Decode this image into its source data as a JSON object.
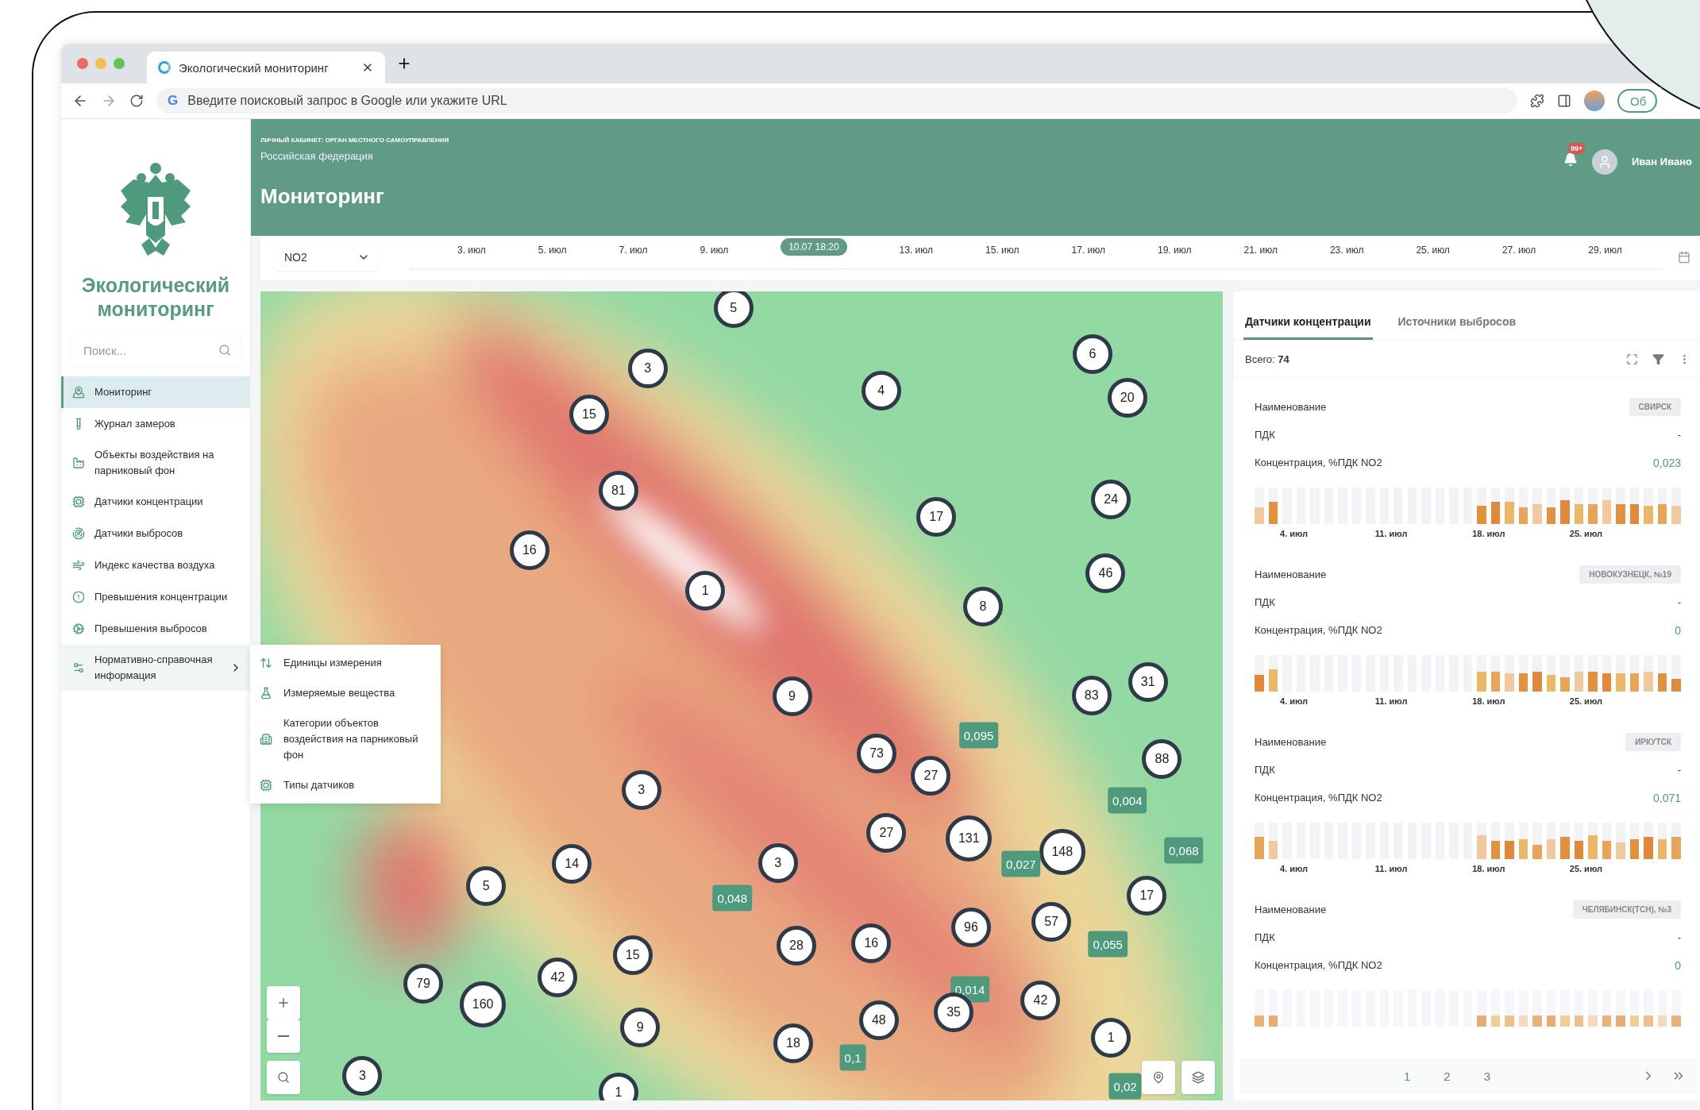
{
  "browser": {
    "search_engine_mark": "G",
    "tab_title": "Экологический мониторинг",
    "address_placeholder": "Введите поисковый запрос в Google или укажите URL",
    "profile_button": "Об"
  },
  "sidebar": {
    "title": "Экологический мониторинг",
    "search": {
      "placeholder": "Поиск..."
    },
    "items": [
      {
        "label": "Мониторинг",
        "selected": true,
        "expanded": false
      },
      {
        "label": "Журнал замеров",
        "selected": false,
        "expanded": false
      },
      {
        "label": "Объекты воздействия на парниковый фон",
        "selected": false,
        "expanded": false
      },
      {
        "label": "Датчики концентрации",
        "selected": false,
        "expanded": false
      },
      {
        "label": "Датчики выбросов",
        "selected": false,
        "expanded": false
      },
      {
        "label": "Индекс качества воздуха",
        "selected": false,
        "expanded": false
      },
      {
        "label": "Превышения концентрации",
        "selected": false,
        "expanded": false
      },
      {
        "label": "Превышения выбросов",
        "selected": false,
        "expanded": false
      },
      {
        "label": "Нормативно-справочная информация",
        "selected": false,
        "expanded": true,
        "children": [
          {
            "label": "Единицы измерения"
          },
          {
            "label": "Измеряемые вещества"
          },
          {
            "label": "Категории объектов воздействия на парниковый фон"
          },
          {
            "label": "Типы датчиков"
          }
        ]
      }
    ]
  },
  "header": {
    "account_label": "ЛИЧНЫЙ КАБИНЕТ: ОРГАН МЕСТНОГО САМОУПРАВЛЕНИЯ",
    "region": "Российская федерация",
    "title": "Мониторинг",
    "notifications_badge": "99+",
    "user_name": "Иван Ивано"
  },
  "timeline": {
    "substance": "NO2",
    "dates": [
      {
        "kind": "date",
        "label": "3. июл"
      },
      {
        "kind": "date",
        "label": "5. июл"
      },
      {
        "kind": "date",
        "label": "7. июл"
      },
      {
        "kind": "date",
        "label": "9. июл"
      },
      {
        "kind": "current",
        "label": "10.07 18:20"
      },
      {
        "kind": "date",
        "label": "13. июл"
      },
      {
        "kind": "date",
        "label": "15. июл"
      },
      {
        "kind": "date",
        "label": "17. июл"
      },
      {
        "kind": "date",
        "label": "19. июл"
      },
      {
        "kind": "date",
        "label": "21. июл"
      },
      {
        "kind": "date",
        "label": "23. июл"
      },
      {
        "kind": "date",
        "label": "25. июл"
      },
      {
        "kind": "date",
        "label": "27. июл"
      },
      {
        "kind": "date",
        "label": "29. июл"
      }
    ]
  },
  "map": {
    "markers": [
      {
        "kind": "cluster",
        "label": "5"
      },
      {
        "kind": "cluster",
        "label": "3"
      },
      {
        "kind": "cluster",
        "label": "4"
      },
      {
        "kind": "cluster",
        "label": "6"
      },
      {
        "kind": "cluster",
        "label": "20"
      },
      {
        "kind": "cluster",
        "label": "15"
      },
      {
        "kind": "cluster",
        "label": "81"
      },
      {
        "kind": "cluster",
        "label": "17"
      },
      {
        "kind": "cluster",
        "label": "24"
      },
      {
        "kind": "cluster",
        "label": "16"
      },
      {
        "kind": "cluster",
        "label": "1"
      },
      {
        "kind": "cluster",
        "label": "8"
      },
      {
        "kind": "cluster",
        "label": "46"
      },
      {
        "kind": "cluster",
        "label": "9"
      },
      {
        "kind": "cluster",
        "label": "83"
      },
      {
        "kind": "cluster",
        "label": "31"
      },
      {
        "kind": "cluster",
        "label": "73"
      },
      {
        "kind": "cluster",
        "label": "27"
      },
      {
        "kind": "cluster",
        "label": "88"
      },
      {
        "kind": "cluster",
        "label": "3"
      },
      {
        "kind": "cluster",
        "label": "27"
      },
      {
        "kind": "cluster",
        "label": "131"
      },
      {
        "kind": "cluster",
        "label": "148"
      },
      {
        "kind": "cluster",
        "label": "14"
      },
      {
        "kind": "cluster",
        "label": "3"
      },
      {
        "kind": "cluster",
        "label": "5"
      },
      {
        "kind": "cluster",
        "label": "17"
      },
      {
        "kind": "cluster",
        "label": "57"
      },
      {
        "kind": "cluster",
        "label": "96"
      },
      {
        "kind": "cluster",
        "label": "28"
      },
      {
        "kind": "cluster",
        "label": "16"
      },
      {
        "kind": "cluster",
        "label": "15"
      },
      {
        "kind": "cluster",
        "label": "79"
      },
      {
        "kind": "cluster",
        "label": "160"
      },
      {
        "kind": "cluster",
        "label": "42"
      },
      {
        "kind": "cluster",
        "label": "42"
      },
      {
        "kind": "cluster",
        "label": "9"
      },
      {
        "kind": "cluster",
        "label": "48"
      },
      {
        "kind": "cluster",
        "label": "35"
      },
      {
        "kind": "cluster",
        "label": "18"
      },
      {
        "kind": "cluster",
        "label": "1"
      },
      {
        "kind": "cluster",
        "label": "3"
      },
      {
        "kind": "cluster",
        "label": "1"
      },
      {
        "kind": "value",
        "label": "0,095"
      },
      {
        "kind": "value",
        "label": "0,004"
      },
      {
        "kind": "value",
        "label": "0,027"
      },
      {
        "kind": "value",
        "label": "0,068"
      },
      {
        "kind": "value",
        "label": "0,048"
      },
      {
        "kind": "value",
        "label": "0,055"
      },
      {
        "kind": "value",
        "label": "0,014"
      },
      {
        "kind": "value",
        "label": "0,1"
      },
      {
        "kind": "value",
        "label": "0,02"
      }
    ]
  },
  "panel": {
    "tabs": [
      {
        "label": "Датчики концентрации",
        "selected": true
      },
      {
        "label": "Источники выбросов",
        "selected": false
      }
    ],
    "total": "Всего: **74**",
    "cards": [
      {
        "name_label": "Наименование",
        "name": "СВИРСК",
        "limit_label": "ПДК",
        "limit": "-",
        "concentration_label": "Концентрация, %ПДК NO2",
        "concentration": "0,023",
        "axis_labels": [
          "4. июл",
          "11. июл",
          "18. июл",
          "25. июл"
        ]
      },
      {
        "name_label": "Наименование",
        "name": "НОВОКУЗНЕЦК, №19",
        "limit_label": "ПДК",
        "limit": "-",
        "concentration_label": "Концентрация, %ПДК NO2",
        "concentration": "0",
        "axis_labels": [
          "4. июл",
          "11. июл",
          "18. июл",
          "25. июл"
        ]
      },
      {
        "name_label": "Наименование",
        "name": "ИРКУТСК",
        "limit_label": "ПДК",
        "limit": "-",
        "concentration_label": "Концентрация, %ПДК NO2",
        "concentration": "0,071",
        "axis_labels": [
          "4. июл",
          "11. июл",
          "18. июл",
          "25. июл"
        ]
      },
      {
        "name_label": "Наименование",
        "name": "ЧЕЛЯБИНСК(ТСН), №3",
        "limit_label": "ПДК",
        "limit": "-",
        "concentration_label": "Концентрация, %ПДК NO2",
        "concentration": "0"
      }
    ],
    "pagination": {
      "pages": [
        {
          "label": "1",
          "selected": true
        },
        {
          "label": "2",
          "selected": false
        },
        {
          "label": "3",
          "selected": false
        }
      ]
    }
  }
}
